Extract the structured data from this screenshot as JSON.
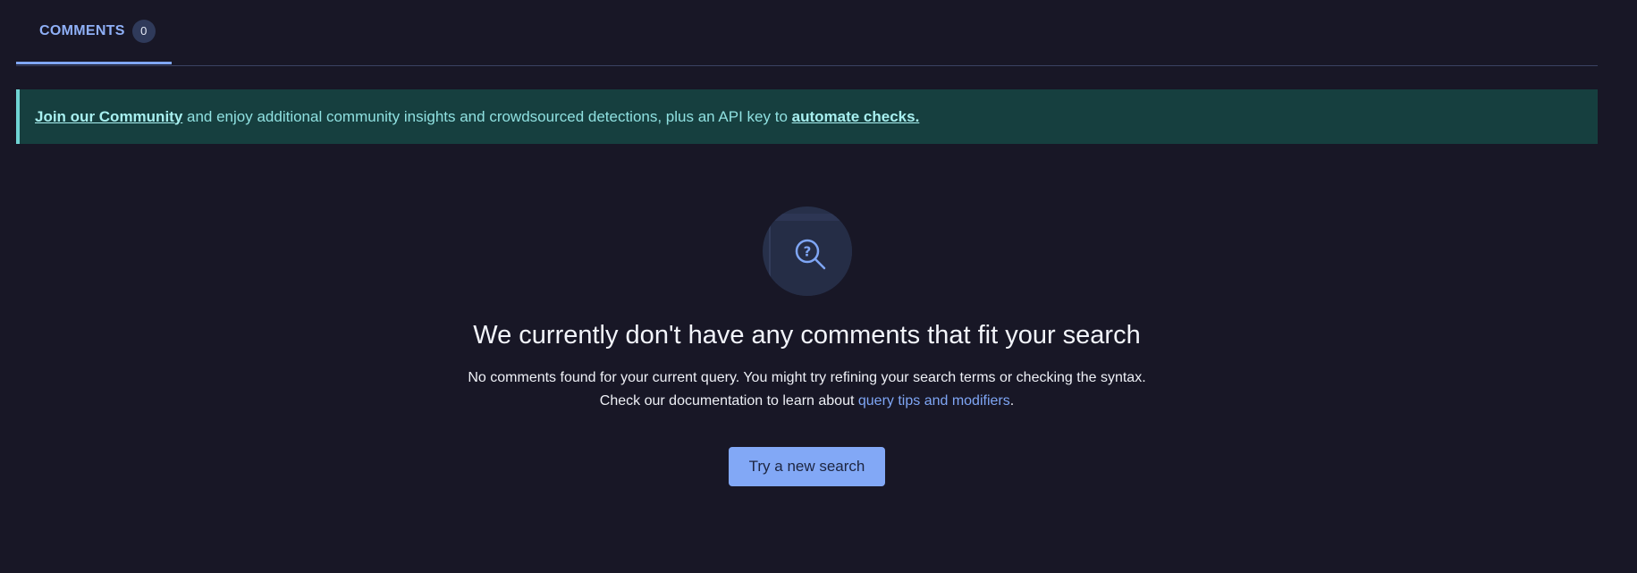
{
  "tabs": [
    {
      "label": "COMMENTS",
      "count": "0"
    }
  ],
  "banner": {
    "link1": "Join our Community",
    "text": " and enjoy additional community insights and crowdsourced detections, plus an API key to ",
    "link2": "automate checks."
  },
  "empty_state": {
    "icon": "search-question-icon",
    "title": "We currently don't have any comments that fit your search",
    "line1": "No comments found for your current query. You might try refining your search terms or checking the syntax.",
    "line2_prefix": "Check our documentation to learn about ",
    "line2_link": "query tips and modifiers",
    "line2_suffix": ".",
    "button_label": "Try a new search"
  },
  "colors": {
    "background": "#181726",
    "accent": "#7fa6f5",
    "banner_bg": "#163f3f",
    "banner_text": "#8fe0e0"
  }
}
